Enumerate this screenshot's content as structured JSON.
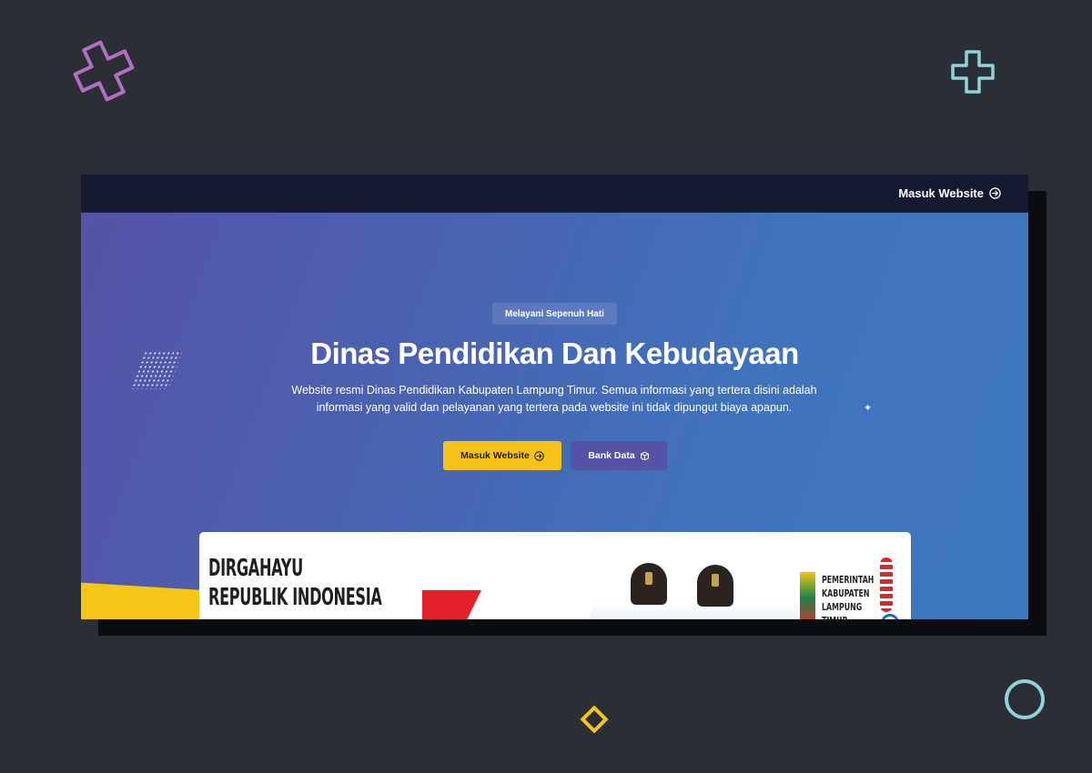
{
  "topbar": {
    "link_label": "Masuk Website",
    "link_icon": "arrow-right-circle-icon"
  },
  "hero": {
    "badge": "Melayani Sepenuh Hati",
    "title": "Dinas Pendidikan Dan Kebudayaan",
    "description": "Website resmi Dinas Pendidikan Kabupaten Lampung Timur. Semua informasi yang tertera disini adalah informasi yang valid dan pelayanan yang tertera pada website ini tidak dipungut biaya apapun.",
    "primary_button": "Masuk Website",
    "primary_icon": "arrow-right-circle-icon",
    "secondary_button": "Bank Data",
    "secondary_icon": "cube-icon"
  },
  "banner": {
    "line1": "DIRGAHAYU",
    "line2": "REPUBLIK INDONESIA",
    "pemkab_line1": "PEMERINTAH",
    "pemkab_line2": "KABUPATEN",
    "pemkab_line3": "LAMPUNG TIMUR"
  },
  "colors": {
    "page_bg": "#2b2e34",
    "topbar_bg": "#151a30",
    "hero_start": "#5553a6",
    "hero_end": "#3c78bf",
    "accent_yellow": "#f7c21a",
    "secondary_button": "#5553a6",
    "deco_pink": "#b06fc0",
    "deco_teal": "#8fd3da"
  }
}
